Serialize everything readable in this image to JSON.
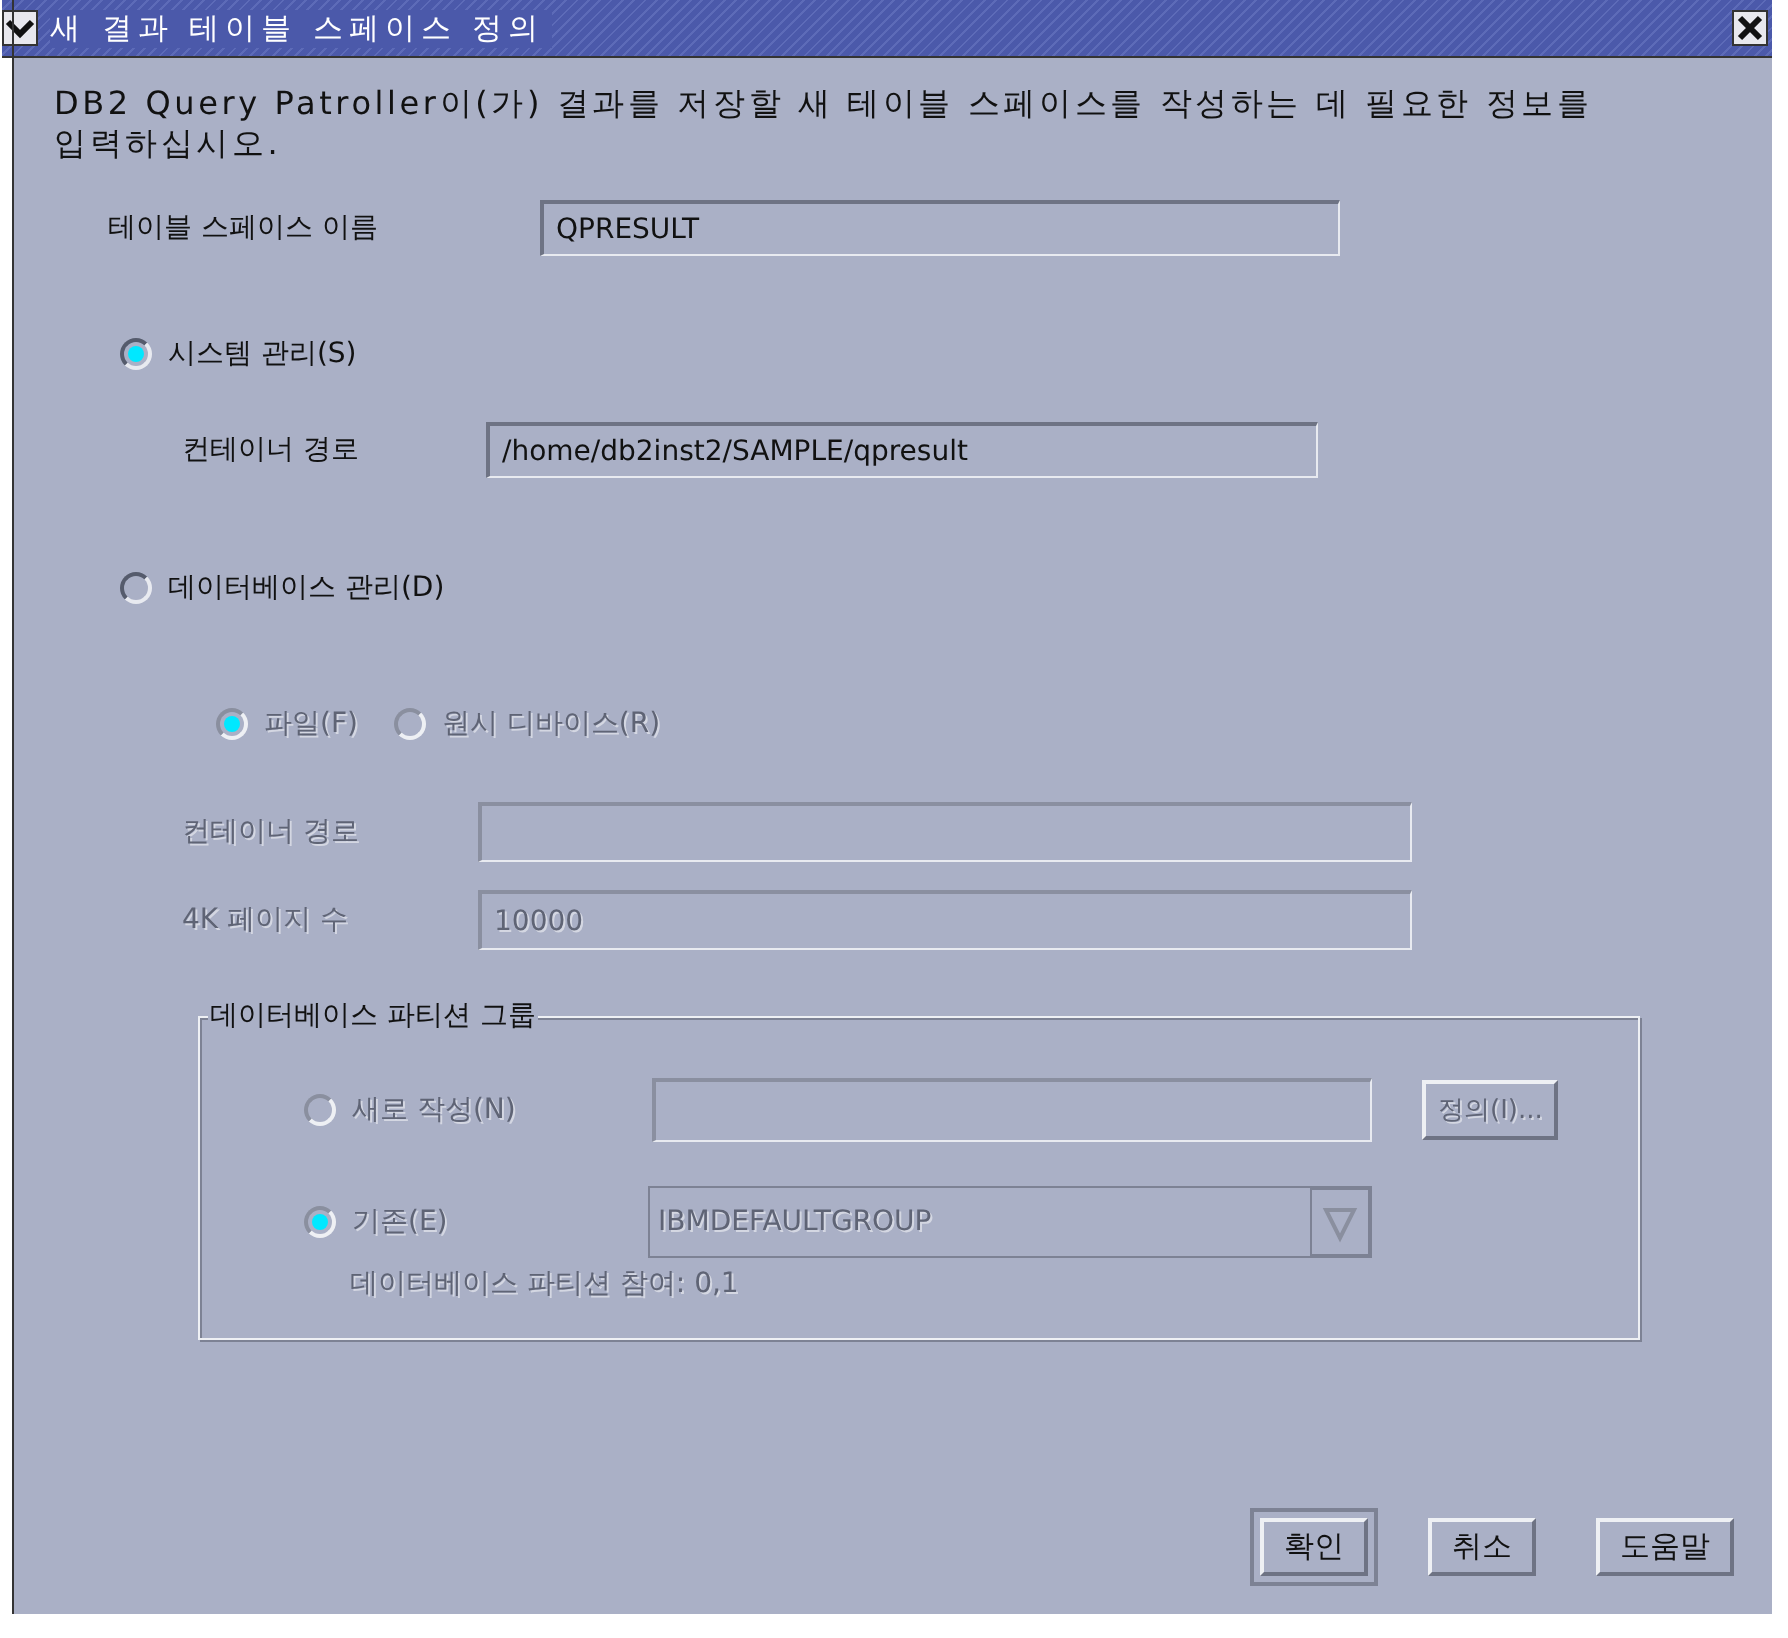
{
  "window": {
    "title": "새 결과 테이블 스페이스 정의"
  },
  "description": "DB2 Query Patroller이(가) 결과를 저장할 새 테이블 스페이스를 작성하는 데 필요한 정보를 입력하십시오.",
  "tablespace_name": {
    "label": "테이블 스페이스 이름",
    "value": "QPRESULT"
  },
  "system_managed": {
    "label": "시스템 관리(S)",
    "selected": true,
    "container_path": {
      "label": "컨테이너 경로",
      "value": "/home/db2inst2/SAMPLE/qpresult"
    }
  },
  "database_managed": {
    "label": "데이터베이스 관리(D)",
    "selected": false,
    "storage_types": [
      {
        "label": "파일(F)",
        "selected": true,
        "disabled": true
      },
      {
        "label": "원시 디바이스(R)",
        "selected": false,
        "disabled": true
      }
    ],
    "fields": [
      {
        "label": "컨테이너 경로",
        "disabled": true
      },
      {
        "label": "4K 페이지 수",
        "value": "10000",
        "disabled": true
      }
    ],
    "partition_group": {
      "title": "데이터베이스 파티션 그룹",
      "options": [
        {
          "kind": "field",
          "label": "새로 작성(N)",
          "selected": false,
          "disabled": true,
          "button": "정의(I)..."
        },
        {
          "kind": "dropdown",
          "label": "기존(E)",
          "selected": true,
          "disabled": true,
          "value": "IBMDEFAULTGROUP"
        }
      ],
      "participation": {
        "text": "데이터베이스 파티션 참여: 0,1",
        "disabled": true
      }
    }
  },
  "buttons": [
    {
      "label": "확인",
      "default": true
    },
    {
      "label": "취소",
      "default": false
    },
    {
      "label": "도움말",
      "default": false
    }
  ]
}
